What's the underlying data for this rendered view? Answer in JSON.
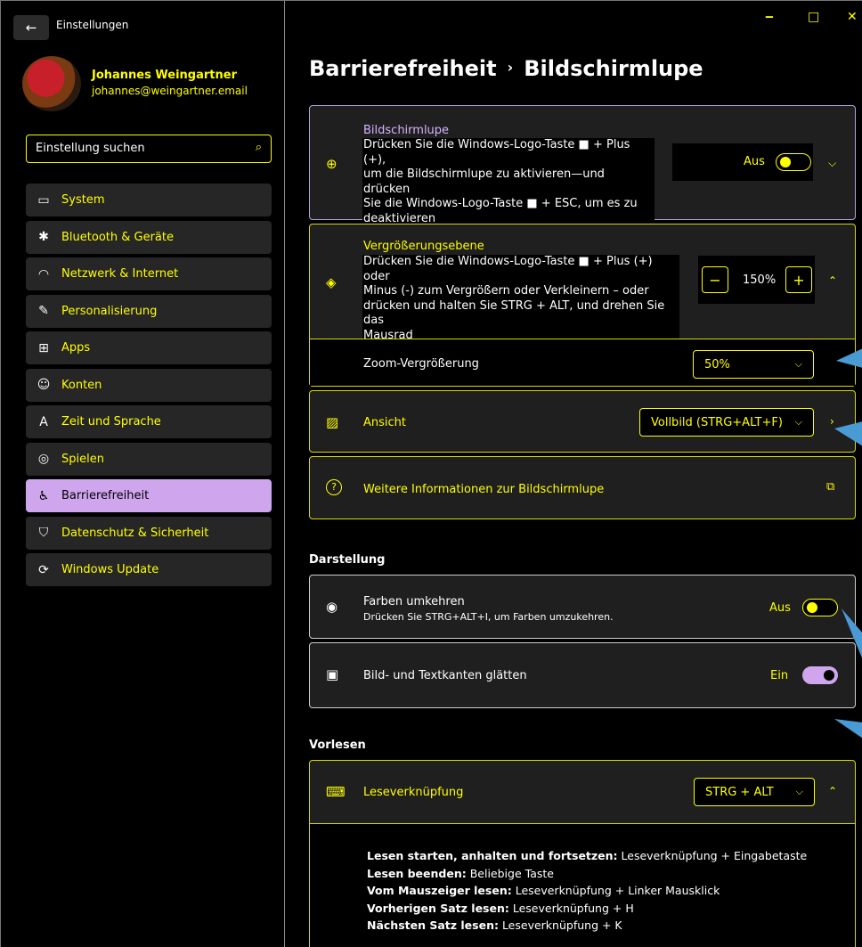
{
  "window": {
    "app_title": "Einstellungen",
    "back_icon": "←",
    "minimize_icon": "‒",
    "maximize_icon": "□",
    "close_icon": "✕"
  },
  "profile": {
    "name": "Johannes Weingartner",
    "email": "johannes@weingartner.email"
  },
  "search": {
    "placeholder": "Einstellung suchen",
    "icon": "⌕"
  },
  "sidebar": {
    "items": [
      {
        "label": "System",
        "icon": "▭"
      },
      {
        "label": "Bluetooth & Geräte",
        "icon": "✱"
      },
      {
        "label": "Netzwerk & Internet",
        "icon": "◠"
      },
      {
        "label": "Personalisierung",
        "icon": "✎"
      },
      {
        "label": "Apps",
        "icon": "⊞"
      },
      {
        "label": "Konten",
        "icon": "☺"
      },
      {
        "label": "Zeit und Sprache",
        "icon": "A"
      },
      {
        "label": "Spielen",
        "icon": "◎"
      },
      {
        "label": "Barrierefreiheit",
        "icon": "♿"
      },
      {
        "label": "Datenschutz & Sicherheit",
        "icon": "⛉"
      },
      {
        "label": "Windows Update",
        "icon": "⟳"
      }
    ],
    "active_index": 8
  },
  "breadcrumb": {
    "parent": "Barrierefreiheit",
    "separator": "›",
    "current": "Bildschirmlupe"
  },
  "magnifier": {
    "title": "Bildschirmlupe",
    "desc": [
      "Drücken Sie die Windows-Logo-Taste ■ + Plus (+),",
      "um die Bildschirmlupe zu aktivieren—und drücken",
      "Sie die Windows-Logo-Taste ■ + ESC, um es zu",
      "deaktivieren"
    ],
    "toggle_label": "Aus",
    "toggle_on": false,
    "icon": "⊕"
  },
  "zoom_level": {
    "title": "Vergrößerungsebene",
    "desc": [
      "Drücken Sie die Windows-Logo-Taste ■ + Plus (+) oder",
      "Minus (-) zum Vergrößern oder Verkleinern – oder",
      "drücken und halten Sie STRG + ALT, und drehen Sie das",
      "Mausrad"
    ],
    "value": "150%",
    "minus": "−",
    "plus": "+",
    "icon": "◈"
  },
  "zoom_increment": {
    "label": "Zoom-Vergrößerung",
    "value": "50%"
  },
  "view": {
    "label": "Ansicht",
    "value": "Vollbild (STRG+ALT+F)",
    "icon": "▨"
  },
  "more_info": {
    "label": "Weitere Informationen zur Bildschirmlupe",
    "icon": "?",
    "external_icon": "⧉"
  },
  "section_appearance": "Darstellung",
  "invert_colors": {
    "title": "Farben umkehren",
    "desc": "Drücken Sie STRG+ALT+I, um Farben umzukehren.",
    "toggle_label": "Aus",
    "toggle_on": false,
    "icon": "◉"
  },
  "smooth_edges": {
    "title": "Bild- und Textkanten glätten",
    "toggle_label": "Ein",
    "toggle_on": true,
    "icon": "▣"
  },
  "section_reading": "Vorlesen",
  "reading_shortcut": {
    "label": "Leseverknüpfung",
    "value": "STRG + ALT",
    "icon": "⌨"
  },
  "reading_help": [
    {
      "bold": "Lesen starten, anhalten und fortsetzen:",
      "text": " Leseverknüpfung + Eingabetaste"
    },
    {
      "bold": "Lesen beenden:",
      "text": " Beliebige Taste"
    },
    {
      "bold": "Vom Mauszeiger lesen:",
      "text": " Leseverknüpfung + Linker Mausklick"
    },
    {
      "bold": "Vorherigen Satz lesen:",
      "text": " Leseverknüpfung + H"
    },
    {
      "bold": "Nächsten Satz lesen:",
      "text": " Leseverknüpfung + K"
    }
  ],
  "colors": {
    "accent_yellow": "#ffff00",
    "accent_purple": "#cfa6ee",
    "callout_blue": "#4a9ad4"
  }
}
